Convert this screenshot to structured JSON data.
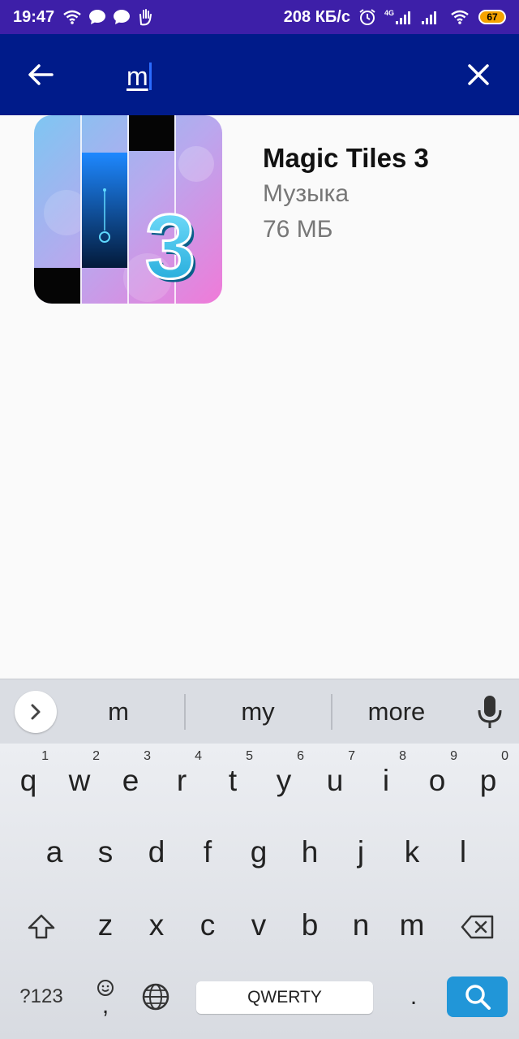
{
  "status_bar": {
    "time": "19:47",
    "speed": "208 КБ/с",
    "network": "4G",
    "battery": "67"
  },
  "app_bar": {
    "search_value": "m",
    "back_icon": "arrow-left-icon",
    "clear_icon": "close-icon"
  },
  "result": {
    "title": "Magic Tiles 3",
    "category": "Музыка",
    "size": "76 МБ"
  },
  "keyboard": {
    "suggestions": [
      "m",
      "my",
      "more"
    ],
    "row1": [
      {
        "key": "q",
        "hint": "1"
      },
      {
        "key": "w",
        "hint": "2"
      },
      {
        "key": "e",
        "hint": "3"
      },
      {
        "key": "r",
        "hint": "4"
      },
      {
        "key": "t",
        "hint": "5"
      },
      {
        "key": "y",
        "hint": "6"
      },
      {
        "key": "u",
        "hint": "7"
      },
      {
        "key": "i",
        "hint": "8"
      },
      {
        "key": "o",
        "hint": "9"
      },
      {
        "key": "p",
        "hint": "0"
      }
    ],
    "row2": [
      "a",
      "s",
      "d",
      "f",
      "g",
      "h",
      "j",
      "k",
      "l"
    ],
    "row3": [
      "z",
      "x",
      "c",
      "v",
      "b",
      "n",
      "m"
    ],
    "symbols_label": "?123",
    "comma_label": ",",
    "space_label": "QWERTY",
    "period_label": "."
  },
  "colors": {
    "status_bar": "#3d1fa8",
    "app_bar": "#001b8a",
    "search_key": "#2196d8"
  }
}
